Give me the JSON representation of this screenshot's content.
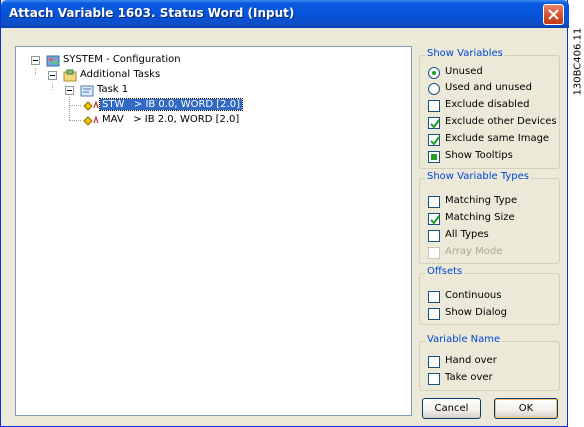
{
  "window": {
    "title": "Attach Variable 1603. Status Word (Input)"
  },
  "side_label": "130BC406.11",
  "tree": {
    "root": {
      "label": "SYSTEM - Configuration",
      "icon": "system-config-icon"
    },
    "additional_tasks": {
      "label": "Additional Tasks",
      "icon": "tasks-folder-icon"
    },
    "task1": {
      "label": "Task 1",
      "icon": "task-icon"
    },
    "variables": [
      {
        "name": "STW",
        "mapping": ">   IB 0.0, WORD [2.0]",
        "selected": true,
        "icon": "input-variable-icon"
      },
      {
        "name": "MAV",
        "mapping": ">   IB 2.0, WORD [2.0]",
        "selected": false,
        "icon": "input-variable-icon"
      }
    ]
  },
  "show_variables": {
    "title": "Show Variables",
    "options": [
      {
        "label": "Unused",
        "type": "radio",
        "checked": true
      },
      {
        "label": "Used and unused",
        "type": "radio",
        "checked": false
      },
      {
        "label": "Exclude disabled",
        "type": "checkbox",
        "checked": false
      },
      {
        "label": "Exclude other Devices",
        "type": "checkbox",
        "checked": true
      },
      {
        "label": "Exclude same Image",
        "type": "checkbox",
        "checked": true
      },
      {
        "label": "Show Tooltips",
        "type": "checkbox",
        "state": "indeterminate"
      }
    ]
  },
  "show_variable_types": {
    "title": "Show Variable Types",
    "options": [
      {
        "label": "Matching Type",
        "checked": false
      },
      {
        "label": "Matching Size",
        "checked": true
      },
      {
        "label": "All Types",
        "checked": false
      },
      {
        "label": "Array Mode",
        "checked": false,
        "disabled": true
      }
    ]
  },
  "offsets": {
    "title": "Offsets",
    "options": [
      {
        "label": "Continuous",
        "checked": false
      },
      {
        "label": "Show Dialog",
        "checked": false
      }
    ]
  },
  "variable_name": {
    "title": "Variable Name",
    "options": [
      {
        "label": "Hand over",
        "checked": false
      },
      {
        "label": "Take over",
        "checked": false
      }
    ]
  },
  "buttons": {
    "cancel": "Cancel",
    "ok": "OK"
  },
  "colors": {
    "titlebar": "#0653d8",
    "selection": "#316ac5",
    "group_title": "#0046d5",
    "check_green": "#21a121"
  }
}
